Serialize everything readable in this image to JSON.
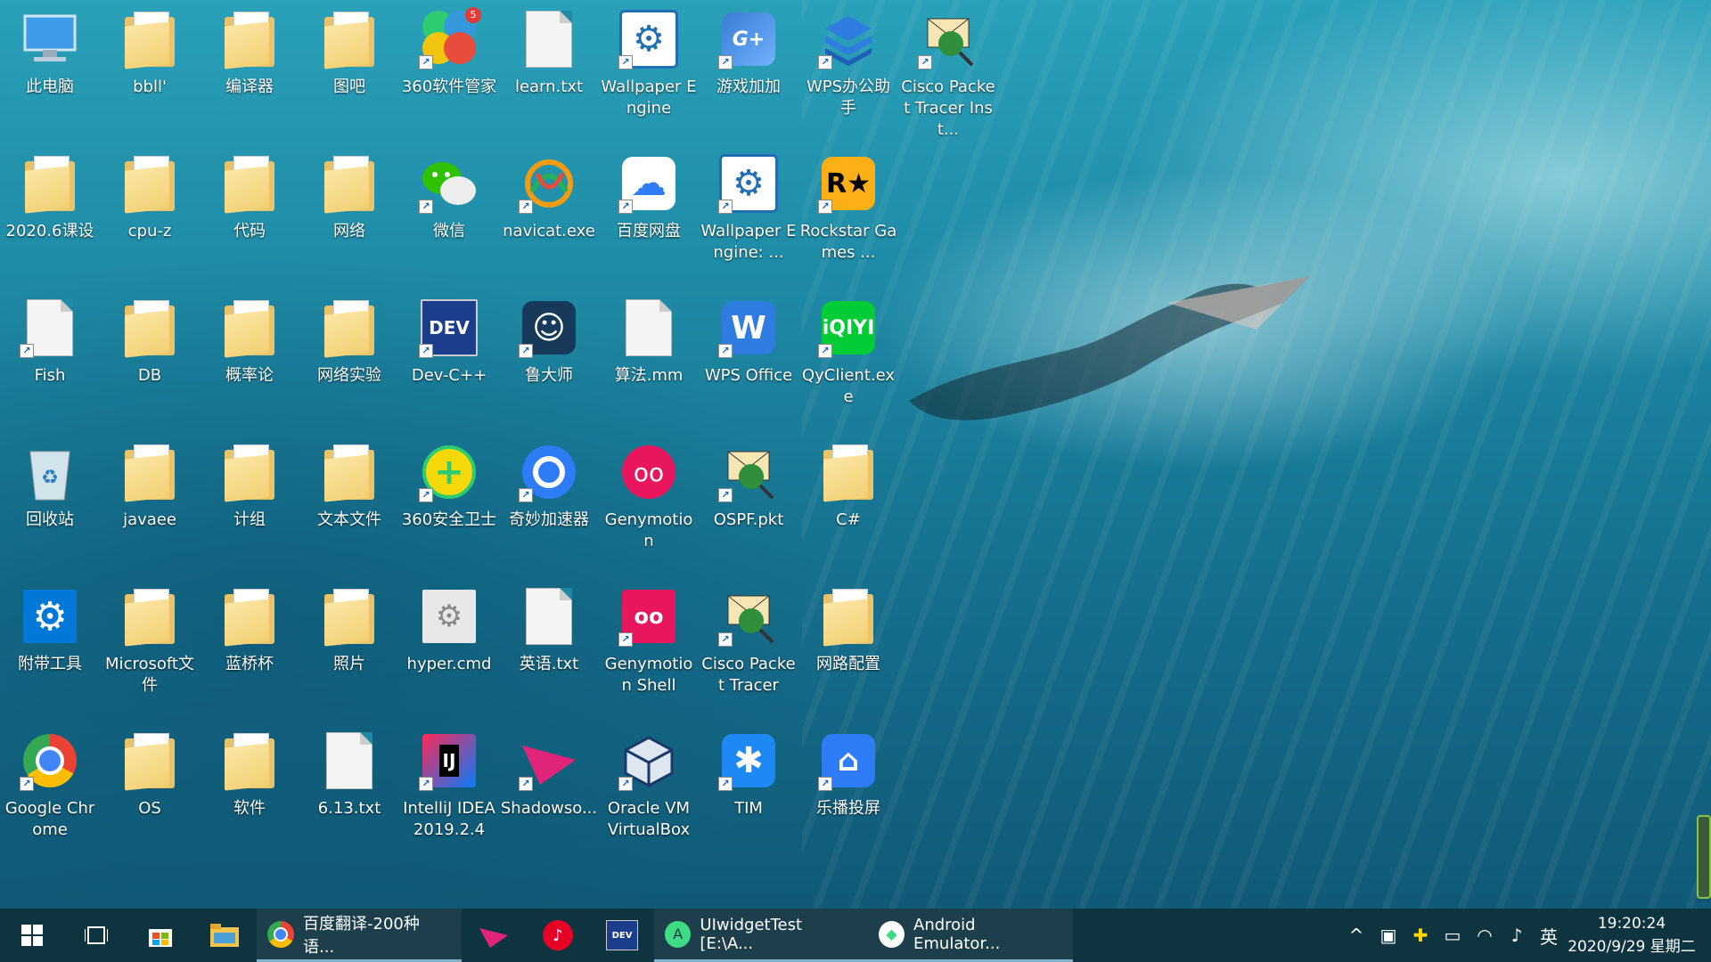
{
  "desktop_icons": [
    {
      "label": "此电脑",
      "type": "pc"
    },
    {
      "label": "bbll'",
      "type": "folder"
    },
    {
      "label": "编译器",
      "type": "folder"
    },
    {
      "label": "图吧",
      "type": "folder"
    },
    {
      "label": "360软件管家",
      "type": "app360mgr",
      "badge": "5"
    },
    {
      "label": "learn.txt",
      "type": "doc"
    },
    {
      "label": "Wallpaper Engine",
      "type": "wallpaper"
    },
    {
      "label": "游戏加加",
      "type": "gameplus"
    },
    {
      "label": "WPS办公助手",
      "type": "wpsassist"
    },
    {
      "label": "Cisco Packet Tracer Inst...",
      "type": "cisco"
    },
    {
      "label": "2020.6课设",
      "type": "folder"
    },
    {
      "label": "cpu-z",
      "type": "folder"
    },
    {
      "label": "代码",
      "type": "folder"
    },
    {
      "label": "网络",
      "type": "folder"
    },
    {
      "label": "微信",
      "type": "wechat"
    },
    {
      "label": "navicat.exe",
      "type": "navicat"
    },
    {
      "label": "百度网盘",
      "type": "baidupan"
    },
    {
      "label": "Wallpaper Engine: ...",
      "type": "wallpaper"
    },
    {
      "label": "Rockstar Games ...",
      "type": "rockstar"
    },
    {
      "label": "Fish",
      "type": "doc"
    },
    {
      "label": "DB",
      "type": "folder"
    },
    {
      "label": "概率论",
      "type": "folder"
    },
    {
      "label": "网络实验",
      "type": "folder"
    },
    {
      "label": "Dev-C++",
      "type": "devcpp"
    },
    {
      "label": "鲁大师",
      "type": "ludashi"
    },
    {
      "label": "算法.mm",
      "type": "doc"
    },
    {
      "label": "WPS Office",
      "type": "wps"
    },
    {
      "label": "QyClient.exe",
      "type": "iqiyi"
    },
    {
      "label": "回收站",
      "type": "recycle"
    },
    {
      "label": "javaee",
      "type": "folder"
    },
    {
      "label": "计组",
      "type": "folder"
    },
    {
      "label": "文本文件",
      "type": "folder"
    },
    {
      "label": "360安全卫士",
      "type": "app360"
    },
    {
      "label": "奇妙加速器",
      "type": "qimiao"
    },
    {
      "label": "Genymotion",
      "type": "genymotion"
    },
    {
      "label": "OSPF.pkt",
      "type": "cisco"
    },
    {
      "label": "C#",
      "type": "folder"
    },
    {
      "label": "附带工具",
      "type": "gear"
    },
    {
      "label": "Microsoft文件",
      "type": "folder"
    },
    {
      "label": "蓝桥杯",
      "type": "folder"
    },
    {
      "label": "照片",
      "type": "folder"
    },
    {
      "label": "hyper.cmd",
      "type": "cmd"
    },
    {
      "label": "英语.txt",
      "type": "doc"
    },
    {
      "label": "Genymotion Shell",
      "type": "genyshell"
    },
    {
      "label": "Cisco Packet Tracer",
      "type": "cisco"
    },
    {
      "label": "网路配置",
      "type": "folder"
    },
    {
      "label": "Google Chrome",
      "type": "chrome"
    },
    {
      "label": "OS",
      "type": "folder"
    },
    {
      "label": "软件",
      "type": "folder"
    },
    {
      "label": "6.13.txt",
      "type": "doc"
    },
    {
      "label": "IntelliJ IDEA 2019.2.4",
      "type": "idea"
    },
    {
      "label": "Shadowso...",
      "type": "shadow"
    },
    {
      "label": "Oracle VM VirtualBox",
      "type": "vbox"
    },
    {
      "label": "TIM",
      "type": "tim"
    },
    {
      "label": "乐播投屏",
      "type": "lebo"
    }
  ],
  "taskbar": {
    "apps": [
      {
        "label": "百度翻译-200种语...",
        "icon": "chrome"
      },
      {
        "label": "UIwidgetTest [E:\\A...",
        "icon": "android-studio"
      },
      {
        "label": "Android Emulator...",
        "icon": "android-emulator"
      }
    ],
    "ime": "英",
    "time": "19:20:24",
    "date": "2020/9/29 星期二"
  }
}
